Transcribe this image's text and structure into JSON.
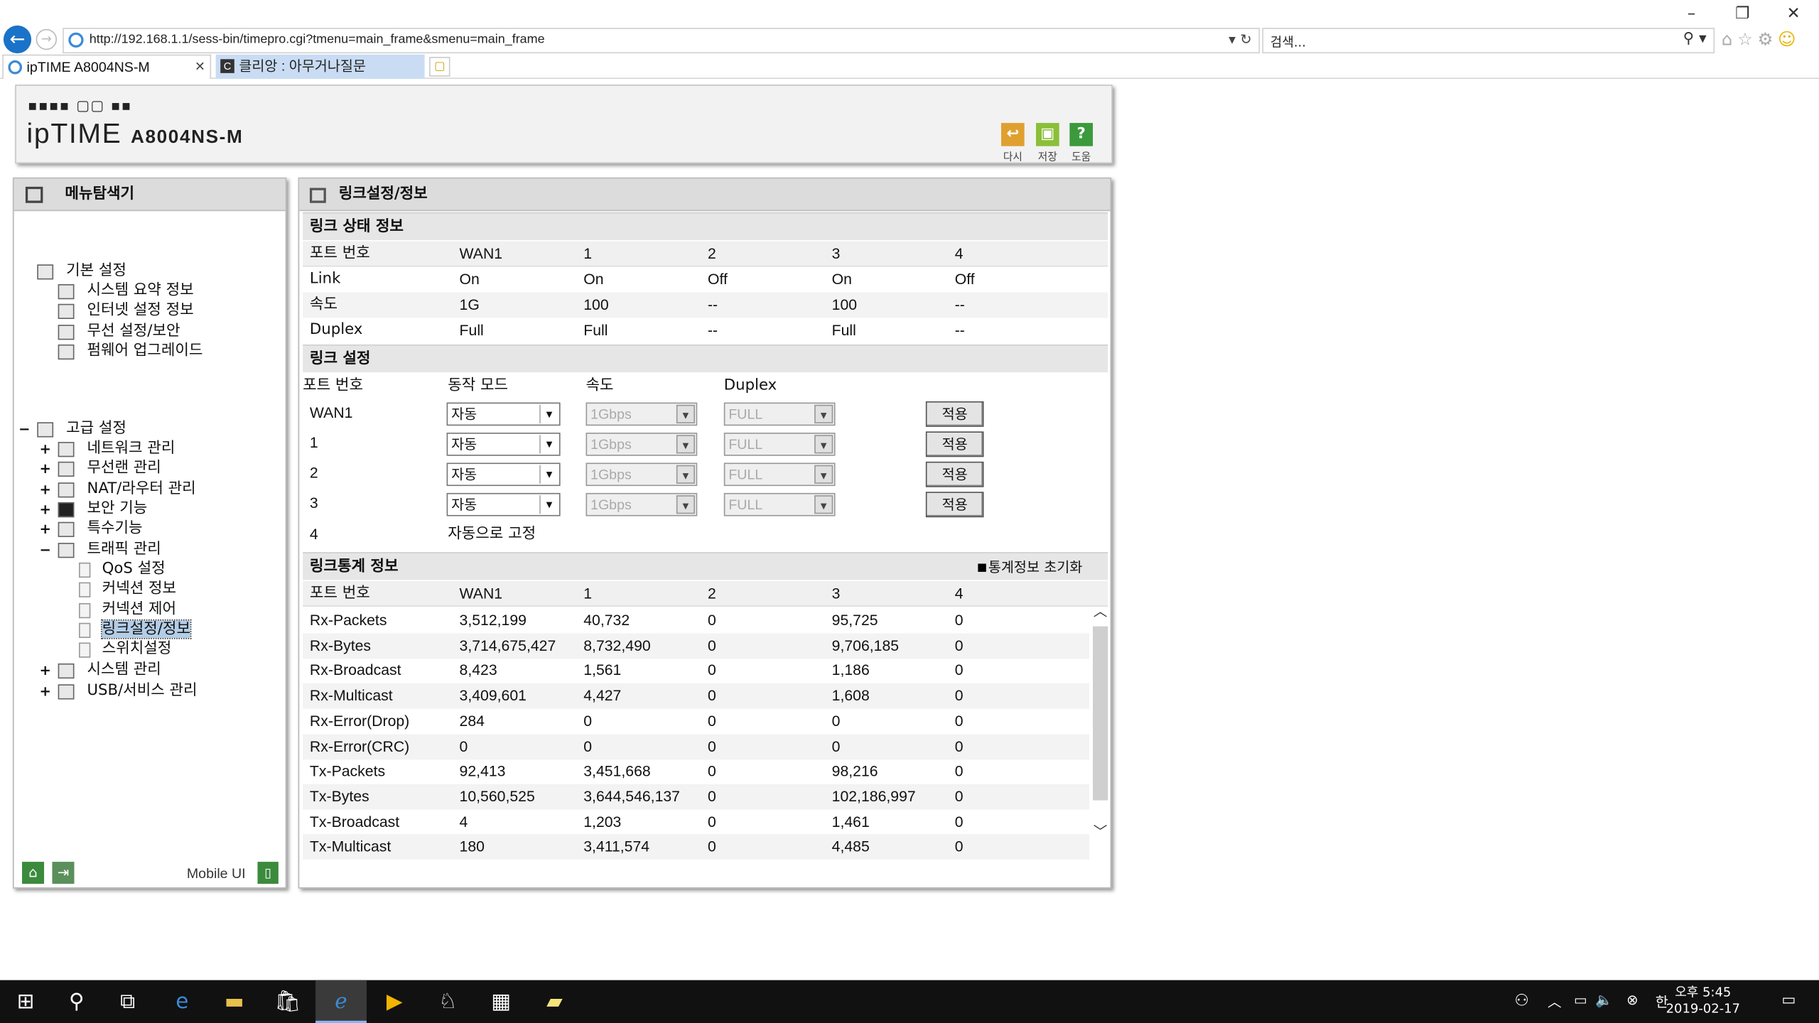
{
  "browser": {
    "url": "http://192.168.1.1/sess-bin/timepro.cgi?tmenu=main_frame&smenu=main_frame",
    "search_placeholder": "검색...",
    "tabs": [
      {
        "label": "ipTIME A8004NS-M"
      },
      {
        "label": "클리앙 : 아무거나질문"
      }
    ]
  },
  "router": {
    "logo_text": "ipTIME",
    "model": "A8004NS-M",
    "buttons": {
      "back": "다시",
      "save": "저장",
      "help": "도움"
    }
  },
  "menu": {
    "title": "메뉴탐색기",
    "basic": {
      "label": "기본 설정",
      "items": [
        "시스템 요약 정보",
        "인터넷 설정 정보",
        "무선 설정/보안",
        "펌웨어 업그레이드"
      ]
    },
    "advanced": {
      "label": "고급 설정",
      "items": [
        "네트워크 관리",
        "무선랜 관리",
        "NAT/라우터 관리",
        "보안 기능",
        "특수기능",
        "트래픽 관리",
        "시스템 관리",
        "USB/서비스 관리"
      ],
      "traffic_children": [
        "QoS 설정",
        "커넥션 정보",
        "커넥션 제어",
        "링크설정/정보",
        "스위치설정"
      ]
    },
    "footer": {
      "mobile": "Mobile UI"
    }
  },
  "page": {
    "title": "링크설정/정보",
    "status": {
      "title": "링크 상태 정보",
      "columns": [
        "포트 번호",
        "WAN1",
        "1",
        "2",
        "3",
        "4"
      ],
      "rows": [
        [
          "Link",
          "On",
          "On",
          "Off",
          "On",
          "Off"
        ],
        [
          "속도",
          "1G",
          "100",
          "--",
          "100",
          "--"
        ],
        [
          "Duplex",
          "Full",
          "Full",
          "--",
          "Full",
          "--"
        ]
      ]
    },
    "settings": {
      "title": "링크 설정",
      "columns": [
        "포트 번호",
        "동작 모드",
        "속도",
        "Duplex"
      ],
      "rows": [
        {
          "port": "WAN1",
          "mode": "자동",
          "speed": "1Gbps",
          "duplex": "FULL",
          "apply": "적용"
        },
        {
          "port": "1",
          "mode": "자동",
          "speed": "1Gbps",
          "duplex": "FULL",
          "apply": "적용"
        },
        {
          "port": "2",
          "mode": "자동",
          "speed": "1Gbps",
          "duplex": "FULL",
          "apply": "적용"
        },
        {
          "port": "3",
          "mode": "자동",
          "speed": "1Gbps",
          "duplex": "FULL",
          "apply": "적용"
        }
      ],
      "fixed": {
        "port": "4",
        "text": "자동으로 고정"
      }
    },
    "stats": {
      "title": "링크통계 정보",
      "reset": "통계정보 초기화",
      "columns": [
        "포트 번호",
        "WAN1",
        "1",
        "2",
        "3",
        "4"
      ],
      "rows": [
        [
          "Rx-Packets",
          "3,512,199",
          "40,732",
          "0",
          "95,725",
          "0"
        ],
        [
          "Rx-Bytes",
          "3,714,675,427",
          "8,732,490",
          "0",
          "9,706,185",
          "0"
        ],
        [
          "Rx-Broadcast",
          "8,423",
          "1,561",
          "0",
          "1,186",
          "0"
        ],
        [
          "Rx-Multicast",
          "3,409,601",
          "4,427",
          "0",
          "1,608",
          "0"
        ],
        [
          "Rx-Error(Drop)",
          "284",
          "0",
          "0",
          "0",
          "0"
        ],
        [
          "Rx-Error(CRC)",
          "0",
          "0",
          "0",
          "0",
          "0"
        ],
        [
          "Tx-Packets",
          "92,413",
          "3,451,668",
          "0",
          "98,216",
          "0"
        ],
        [
          "Tx-Bytes",
          "10,560,525",
          "3,644,546,137",
          "0",
          "102,186,997",
          "0"
        ],
        [
          "Tx-Broadcast",
          "4",
          "1,203",
          "0",
          "1,461",
          "0"
        ],
        [
          "Tx-Multicast",
          "180",
          "3,411,574",
          "0",
          "4,485",
          "0"
        ]
      ]
    }
  },
  "taskbar": {
    "time": "오후 5:45",
    "date": "2019-02-17",
    "ime": "한"
  }
}
